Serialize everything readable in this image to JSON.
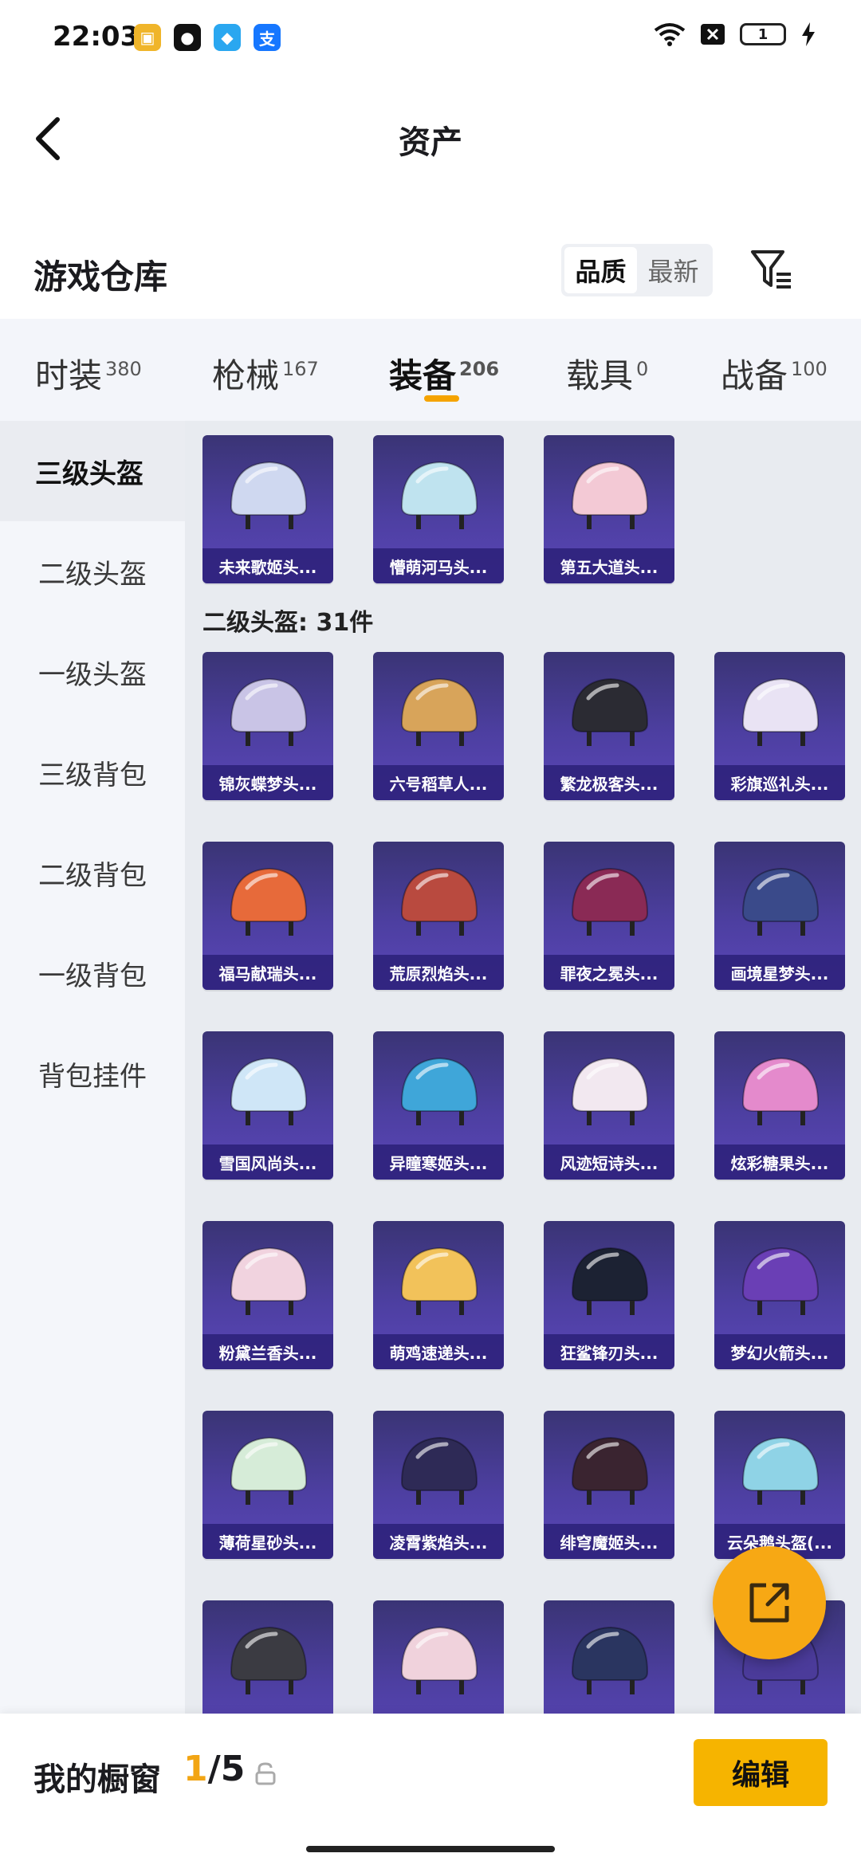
{
  "status": {
    "time": "22:03",
    "battery": "1"
  },
  "header": {
    "title": "资产"
  },
  "section": {
    "title": "游戏仓库",
    "sort_quality": "品质",
    "sort_latest": "最新"
  },
  "tabs": [
    {
      "label": "时装",
      "count": "380"
    },
    {
      "label": "枪械",
      "count": "167"
    },
    {
      "label": "装备",
      "count": "206"
    },
    {
      "label": "载具",
      "count": "0"
    },
    {
      "label": "战备",
      "count": "100"
    }
  ],
  "sidebar": [
    {
      "label": "三级头盔"
    },
    {
      "label": "二级头盔"
    },
    {
      "label": "一级头盔"
    },
    {
      "label": "三级背包"
    },
    {
      "label": "二级背包"
    },
    {
      "label": "一级背包"
    },
    {
      "label": "背包挂件"
    }
  ],
  "top_items": [
    {
      "name": "未来歌姬头...",
      "color": "#cfd8f0"
    },
    {
      "name": "懵萌河马头...",
      "color": "#bfe3ef"
    },
    {
      "name": "第五大道头...",
      "color": "#f3c9d5"
    }
  ],
  "group": {
    "title": "二级头盔: 31件"
  },
  "items": [
    {
      "name": "锦灰蝶梦头...",
      "color": "#c9c4e6"
    },
    {
      "name": "六号稻草人...",
      "color": "#d8a45a"
    },
    {
      "name": "繁龙极客头...",
      "color": "#2b2b33"
    },
    {
      "name": "彩旗巡礼头...",
      "color": "#e9e3f4"
    },
    {
      "name": "福马献瑞头...",
      "color": "#e76a3a"
    },
    {
      "name": "荒原烈焰头...",
      "color": "#b94a3f"
    },
    {
      "name": "罪夜之冕头...",
      "color": "#8a2a55"
    },
    {
      "name": "画境星梦头...",
      "color": "#3a4a8a"
    },
    {
      "name": "雪国风尚头...",
      "color": "#cfe6f7"
    },
    {
      "name": "异瞳寒姬头...",
      "color": "#3fa6d9"
    },
    {
      "name": "风迹短诗头...",
      "color": "#f2e8f0"
    },
    {
      "name": "炫彩糖果头...",
      "color": "#e48acc"
    },
    {
      "name": "粉黛兰香头...",
      "color": "#f1d3df"
    },
    {
      "name": "萌鸡速递头...",
      "color": "#f2c25a"
    },
    {
      "name": "狂鲨锋刃头...",
      "color": "#1c2233"
    },
    {
      "name": "梦幻火箭头...",
      "color": "#6a3fb5"
    },
    {
      "name": "薄荷星砂头...",
      "color": "#d6ecd8"
    },
    {
      "name": "凌霄紫焰头...",
      "color": "#2e2a56"
    },
    {
      "name": "绯穹魔姬头...",
      "color": "#3a2430"
    },
    {
      "name": "云朵鹅头盔(...",
      "color": "#8fd3e6"
    },
    {
      "name": "",
      "color": "#3b3b42"
    },
    {
      "name": "",
      "color": "#f0d2dc"
    },
    {
      "name": "",
      "color": "#2a3560"
    },
    {
      "name": "",
      "color": "#4b3b9a"
    }
  ],
  "bottom": {
    "label": "我的橱窗",
    "current": "1",
    "total": "/5",
    "edit": "编辑"
  },
  "colors": {
    "accent": "#f6b400",
    "card": "#4d3fa1",
    "tab_underline": "#f5a300"
  }
}
